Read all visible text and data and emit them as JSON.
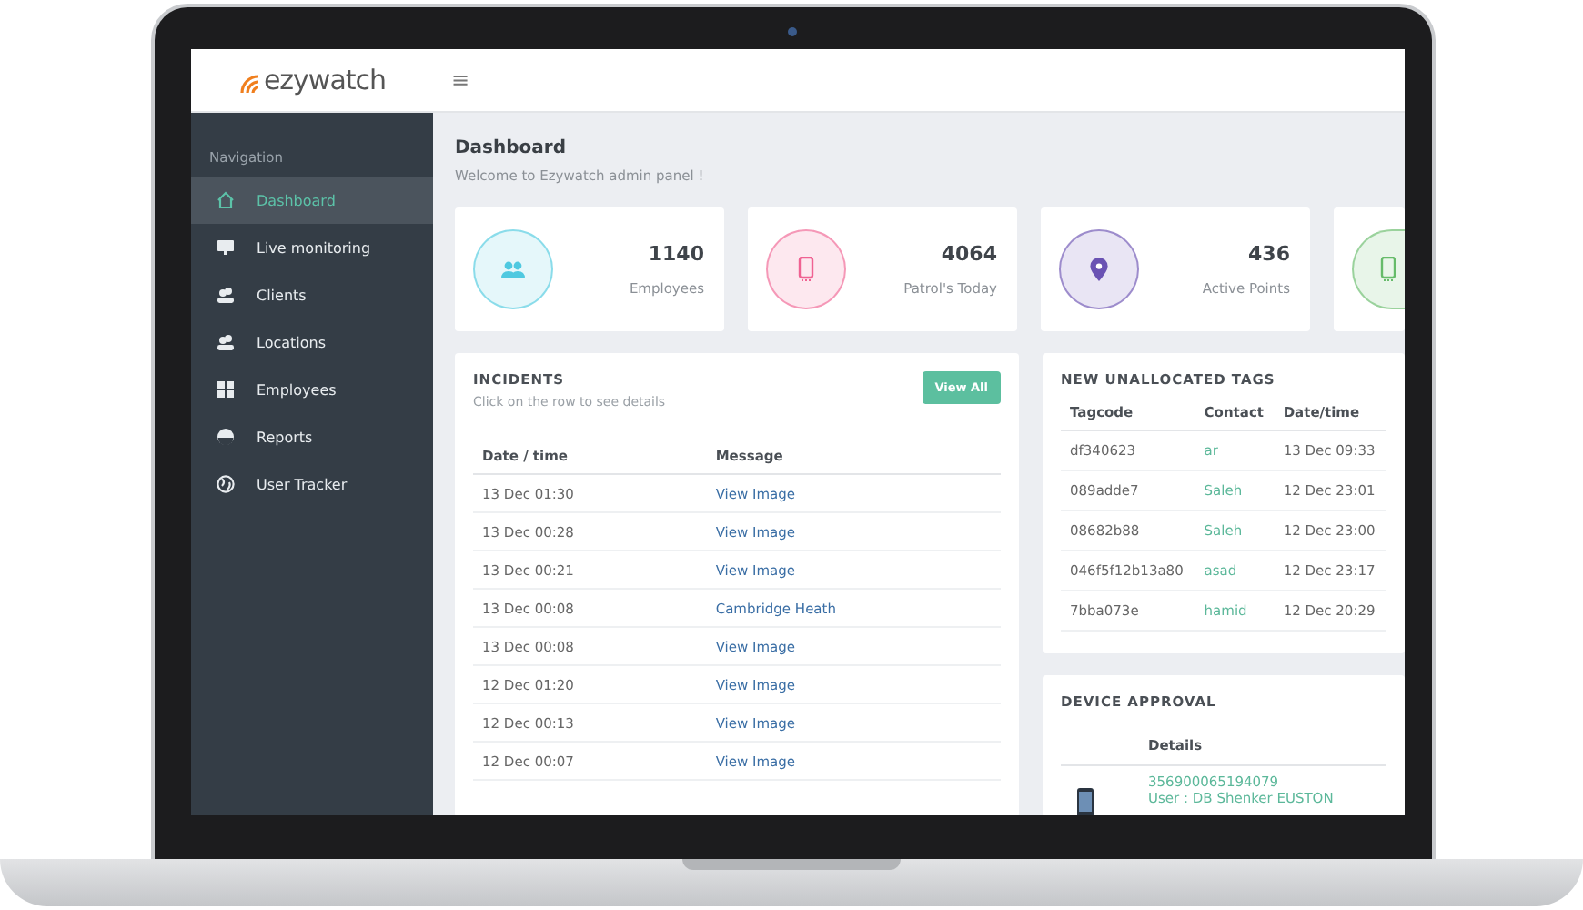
{
  "app": {
    "logo": "ezywatch",
    "menu_glyph": "≡"
  },
  "sidebar": {
    "heading": "Navigation",
    "items": [
      {
        "label": "Dashboard",
        "selected": true
      },
      {
        "label": "Live monitoring",
        "selected": false
      },
      {
        "label": "Clients",
        "selected": false
      },
      {
        "label": "Locations",
        "selected": false
      },
      {
        "label": "Employees",
        "selected": false
      },
      {
        "label": "Reports",
        "selected": false
      },
      {
        "label": "User Tracker",
        "selected": false
      }
    ]
  },
  "page": {
    "title": "Dashboard",
    "subtitle": "Welcome to Ezywatch admin panel !"
  },
  "stats": [
    {
      "value": "1140",
      "label": "Employees",
      "color": "#4fc9e0"
    },
    {
      "value": "4064",
      "label": "Patrol's Today",
      "color": "#f06292"
    },
    {
      "value": "436",
      "label": "Active Points",
      "color": "#6a52b3"
    },
    {
      "color": "#66bb6a"
    }
  ],
  "incidents": {
    "title": "INCIDENTS",
    "subtitle": "Click on the row to see details",
    "button": "View All",
    "columns": [
      "Date / time",
      "Message"
    ],
    "rows": [
      {
        "time": "13 Dec 01:30",
        "message": "View Image"
      },
      {
        "time": "13 Dec 00:28",
        "message": "View Image"
      },
      {
        "time": "13 Dec 00:21",
        "message": "View Image"
      },
      {
        "time": "13 Dec 00:08",
        "message": "Cambridge Heath"
      },
      {
        "time": "13 Dec 00:08",
        "message": "View Image"
      },
      {
        "time": "12 Dec 01:20",
        "message": "View Image"
      },
      {
        "time": "12 Dec 00:13",
        "message": "View Image"
      },
      {
        "time": "12 Dec 00:07",
        "message": "View Image"
      }
    ]
  },
  "tags": {
    "title": "NEW UNALLOCATED TAGS",
    "columns": [
      "Tagcode",
      "Contact",
      "Date/time"
    ],
    "rows": [
      {
        "tagcode": "df340623",
        "contact": "ar",
        "time": "13 Dec 09:33"
      },
      {
        "tagcode": "089adde7",
        "contact": "Saleh",
        "time": "12 Dec 23:01"
      },
      {
        "tagcode": "08682b88",
        "contact": "Saleh",
        "time": "12 Dec 23:00"
      },
      {
        "tagcode": "046f5f12b13a80",
        "contact": "asad",
        "time": "12 Dec 23:17"
      },
      {
        "tagcode": "7bba073e",
        "contact": "hamid",
        "time": "12 Dec 20:29"
      }
    ]
  },
  "devices": {
    "title": "DEVICE APPROVAL",
    "columns": [
      "Details"
    ],
    "rows": [
      {
        "id": "356900065194079",
        "user": "User : DB Shenker EUSTON"
      }
    ]
  }
}
